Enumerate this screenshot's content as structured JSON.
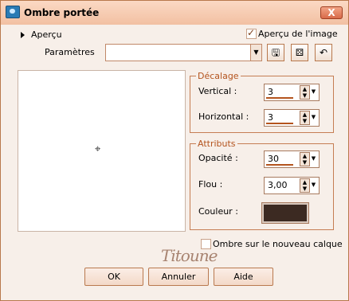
{
  "window": {
    "title": "Ombre portée",
    "close_label": "X"
  },
  "preview_panel": {
    "expand_label": "Aperçu",
    "image_preview_label": "Aperçu de l'image",
    "image_preview_checked": true
  },
  "presets": {
    "label": "Paramètres",
    "value": ""
  },
  "offset": {
    "legend": "Décalage",
    "vertical_label": "Vertical :",
    "vertical_value": "3",
    "horizontal_label": "Horizontal :",
    "horizontal_value": "3"
  },
  "attributes": {
    "legend": "Attributs",
    "opacity_label": "Opacité :",
    "opacity_value": "30",
    "blur_label": "Flou :",
    "blur_value": "3,00",
    "color_label": "Couleur :",
    "color_value": "#3c2a22"
  },
  "new_layer": {
    "label": "Ombre sur le nouveau calque",
    "checked": false
  },
  "watermark": "Titoune",
  "buttons": {
    "ok": "OK",
    "cancel": "Annuler",
    "help": "Aide"
  },
  "icons": [
    "save-icon",
    "dice-icon",
    "reset-icon",
    "crosshair-icon"
  ]
}
